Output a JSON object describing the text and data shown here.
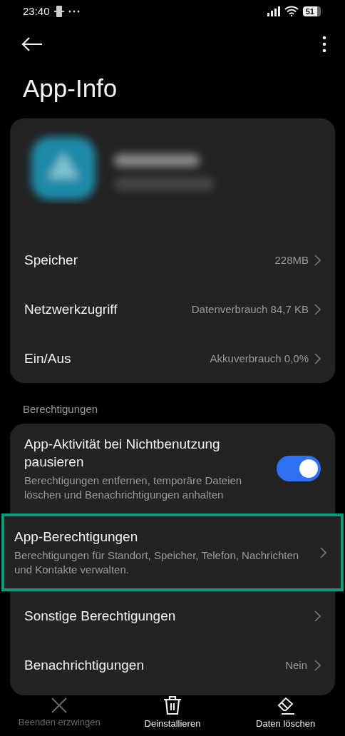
{
  "status_bar": {
    "time": "23:40",
    "battery": "51"
  },
  "header": {
    "title": "App-Info"
  },
  "info_rows": [
    {
      "label": "Speicher",
      "value": "228MB"
    },
    {
      "label": "Netzwerkzugriff",
      "value": "Datenverbrauch 84,7 KB"
    },
    {
      "label": "Ein/Aus",
      "value": "Akkuverbrauch 0,0%"
    }
  ],
  "section_label": "Berechtigungen",
  "permission_rows": [
    {
      "kind": "toggle",
      "title": "App-Aktivität bei Nichtbenutzung pausieren",
      "subtitle": "Berechtigungen entfernen, temporäre Dateien löschen und Benachrichtigungen anhalten",
      "on": true,
      "highlighted": false
    },
    {
      "kind": "link",
      "title": "App-Berechtigungen",
      "subtitle": "Berechtigungen für Standort, Speicher, Telefon, Nachrichten und Kontakte verwalten.",
      "highlighted": true
    },
    {
      "kind": "link",
      "title": "Sonstige Berechtigungen",
      "highlighted": false
    },
    {
      "kind": "link",
      "title": "Benachrichtigungen",
      "value": "Nein",
      "highlighted": false
    }
  ],
  "actions": [
    {
      "kind": "stop",
      "label": "Beenden erzwingen",
      "disabled": true
    },
    {
      "kind": "uninstall",
      "label": "Deinstallieren",
      "disabled": false
    },
    {
      "kind": "clear",
      "label": "Daten löschen",
      "disabled": false
    }
  ]
}
